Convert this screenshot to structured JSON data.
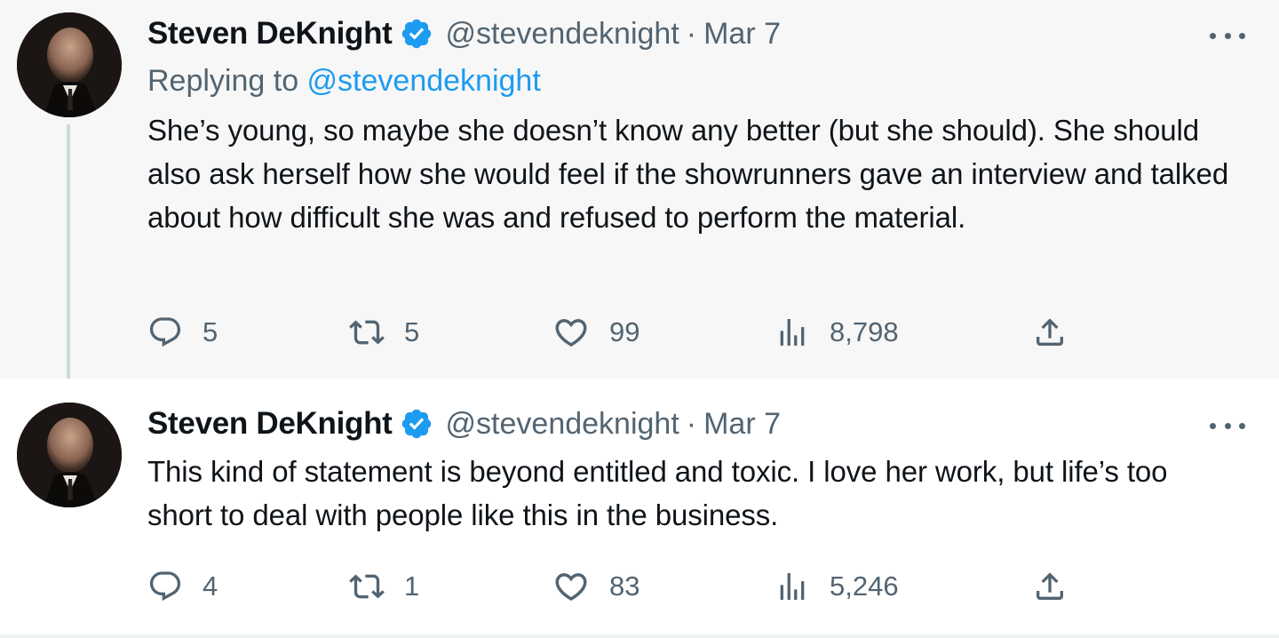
{
  "tweets": [
    {
      "author": {
        "name": "Steven DeKnight",
        "handle": "@stevendeknight"
      },
      "separator": "·",
      "date": "Mar 7",
      "replying": {
        "prefix": "Replying to ",
        "handle": "@stevendeknight"
      },
      "text": "She’s young, so maybe she doesn’t know any better (but she should). She should also ask herself how she would feel if the showrunners gave an interview and talked about how difficult she was and refused to perform the material.",
      "stats": {
        "replies": "5",
        "retweets": "5",
        "likes": "99",
        "views": "8,798"
      }
    },
    {
      "author": {
        "name": "Steven DeKnight",
        "handle": "@stevendeknight"
      },
      "separator": "·",
      "date": "Mar 7",
      "text": "This kind of statement is beyond entitled and toxic. I love her work, but life’s too short to deal with people like this in the business.",
      "stats": {
        "replies": "4",
        "retweets": "1",
        "likes": "83",
        "views": "5,246"
      }
    }
  ],
  "icons": {
    "verified": "verified-badge-icon",
    "more": "more-options-icon",
    "reply": "reply-icon",
    "retweet": "retweet-icon",
    "like": "heart-icon",
    "views": "views-icon",
    "share": "share-icon"
  },
  "colors": {
    "brand_blue": "#1d9bf0",
    "secondary_text": "#536471",
    "primary_text": "#0f1419",
    "highlight_bg": "#f7f7f7"
  }
}
